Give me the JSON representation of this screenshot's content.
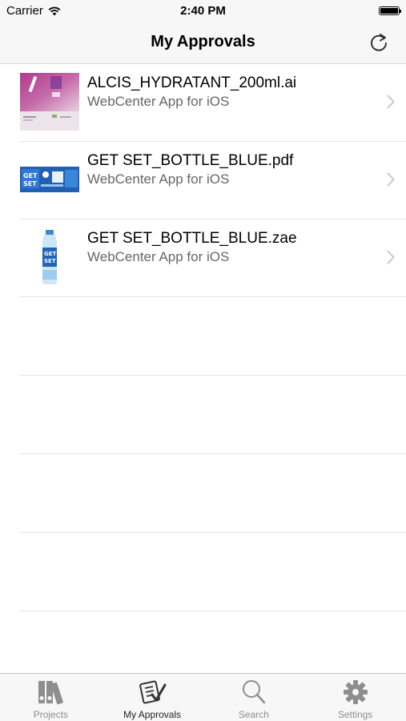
{
  "status_bar": {
    "carrier": "Carrier",
    "time": "2:40 PM"
  },
  "nav": {
    "title": "My Approvals",
    "refresh_icon": "refresh-icon"
  },
  "items": [
    {
      "title": "ALCIS_HYDRATANT_200ml.ai",
      "subtitle": "WebCenter App for iOS",
      "thumb": "pink-label-artwork"
    },
    {
      "title": "GET SET_BOTTLE_BLUE.pdf",
      "subtitle": "WebCenter App for iOS",
      "thumb": "blue-label-flat"
    },
    {
      "title": "GET SET_BOTTLE_BLUE.zae",
      "subtitle": "WebCenter App for iOS",
      "thumb": "blue-bottle-3d"
    }
  ],
  "tabs": [
    {
      "label": "Projects",
      "icon": "binders-icon",
      "active": false
    },
    {
      "label": "My Approvals",
      "icon": "approval-checklist-icon",
      "active": true
    },
    {
      "label": "Search",
      "icon": "search-icon",
      "active": false
    },
    {
      "label": "Settings",
      "icon": "gear-icon",
      "active": false
    }
  ],
  "colors": {
    "bar_background": "#f7f7f7",
    "separator": "#e3e3e3",
    "tab_inactive": "#8e8e8e",
    "tab_active": "#222222"
  }
}
